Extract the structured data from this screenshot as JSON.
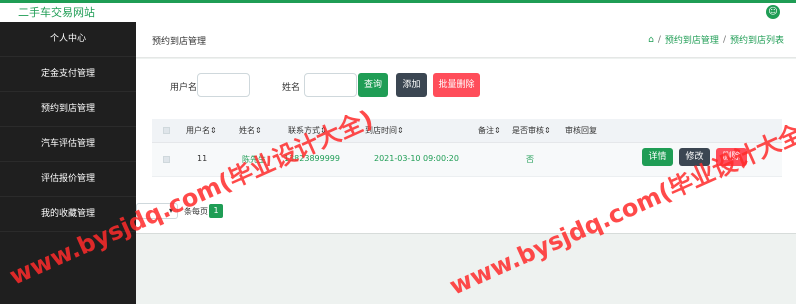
{
  "app": {
    "title": "二手车交易网站",
    "user_icon": "user-icon"
  },
  "sidebar": {
    "items": [
      {
        "label": "个人中心"
      },
      {
        "label": "定金支付管理"
      },
      {
        "label": "预约到店管理"
      },
      {
        "label": "汽车评估管理"
      },
      {
        "label": "评估报价管理"
      },
      {
        "label": "我的收藏管理"
      }
    ]
  },
  "page": {
    "title": "预约到店管理",
    "breadcrumb": [
      {
        "icon": "home-icon",
        "label": ""
      },
      {
        "label": "预约到店管理"
      },
      {
        "label": "预约到店列表"
      }
    ]
  },
  "search": {
    "username_label": "用户名",
    "username_value": "",
    "username_placeholder": "",
    "name_label": "姓名",
    "name_value": "",
    "name_placeholder": "",
    "query_label": "查询",
    "add_label": "添加",
    "batch_delete_label": "批量删除"
  },
  "table": {
    "headers": [
      "用户名",
      "姓名",
      "联系方式",
      "到店时间",
      "备注",
      "是否审核",
      "审核回复"
    ],
    "rows": [
      {
        "username": "11",
        "name": "陈先生",
        "phone": "13823899999",
        "visit_time": "2021-03-10 09:00:20",
        "note": "",
        "audit_status": "否",
        "audit_reply": "",
        "actions": [
          "详情",
          "修改",
          "删除"
        ]
      }
    ]
  },
  "pagination": {
    "per_page_value": "",
    "per_page_label": "条每页",
    "current_page": "1"
  },
  "watermarks": [
    "www.bysjdq.com(毕业设计大全)",
    "www.bysjdq.com(毕业设计大全)"
  ],
  "colors": {
    "accent": "#1f9d55",
    "sidebar_bg": "#1f1f1f",
    "danger": "#ff4d5a",
    "secondary": "#3b4652",
    "watermark": "#ff2b2b"
  }
}
